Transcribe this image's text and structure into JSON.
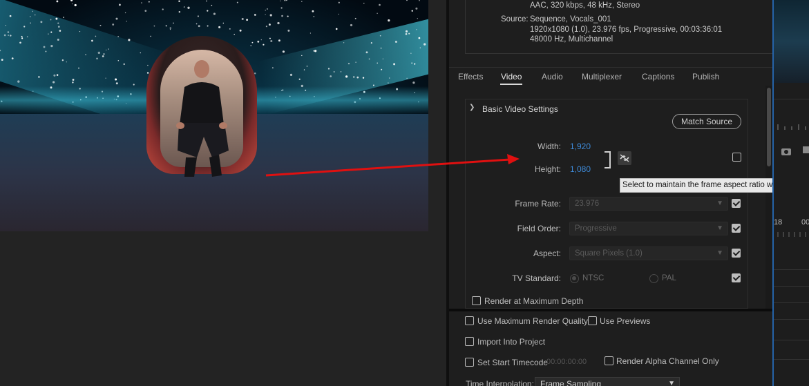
{
  "summary": {
    "audio_line": "AAC, 320 kbps, 48 kHz, Stereo",
    "source_label": "Source:",
    "source_line1": "Sequence, Vocals_001",
    "source_line2": "1920x1080 (1.0), 23.976 fps, Progressive, 00:03:36:01",
    "source_line3": "48000 Hz, Multichannel"
  },
  "tabs": [
    "Effects",
    "Video",
    "Audio",
    "Multiplexer",
    "Captions",
    "Publish"
  ],
  "active_tab": "Video",
  "basic_video": {
    "section_title": "Basic Video Settings",
    "match_source_label": "Match Source",
    "width_label": "Width:",
    "width_value": "1,920",
    "height_label": "Height:",
    "height_value": "1,080",
    "tooltip": "Select to maintain the frame aspect ratio while resizing",
    "frame_rate_label": "Frame Rate:",
    "frame_rate_value": "23.976",
    "field_order_label": "Field Order:",
    "field_order_value": "Progressive",
    "aspect_label": "Aspect:",
    "aspect_value": "Square Pixels (1.0)",
    "tv_standard_label": "TV Standard:",
    "ntsc_label": "NTSC",
    "pal_label": "PAL",
    "render_max_depth_label": "Render at Maximum Depth"
  },
  "bottom_options": {
    "use_max_render_quality": "Use Maximum Render Quality",
    "use_previews": "Use Previews",
    "import_into_project": "Import Into Project",
    "set_start_timecode": "Set Start Timecode",
    "start_timecode_value": "00:00:00:00",
    "render_alpha_only": "Render Alpha Channel Only",
    "time_interpolation_label": "Time Interpolation:",
    "time_interpolation_value": "Frame Sampling"
  },
  "right_strip": {
    "tc_a": "18",
    "tc_b": "00"
  },
  "colors": {
    "accent_blue": "#3e8ad8",
    "arrow_red": "#e01010",
    "panel_bg": "#1e1e1e"
  }
}
